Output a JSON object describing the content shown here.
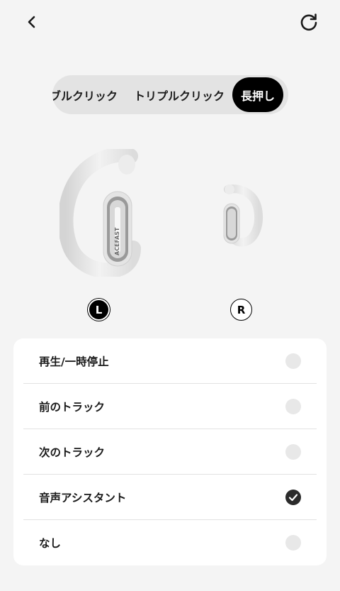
{
  "header": {
    "back_icon": "chevron-left-icon",
    "reset_icon": "refresh-icon"
  },
  "tabs": [
    {
      "label": "ブルクリック",
      "active": false
    },
    {
      "label": "トリプルクリック",
      "active": false
    },
    {
      "label": "長押し",
      "active": true
    }
  ],
  "earbuds": {
    "left_label": "L",
    "right_label": "R",
    "selected": "L",
    "brand_mark": "ACEFAST"
  },
  "options": [
    {
      "label": "再生/一時停止",
      "checked": false
    },
    {
      "label": "前のトラック",
      "checked": false
    },
    {
      "label": "次のトラック",
      "checked": false
    },
    {
      "label": "音声アシスタント",
      "checked": true
    },
    {
      "label": "なし",
      "checked": false
    }
  ],
  "colors": {
    "background": "#f4f4f4",
    "active_tab": "#000000",
    "checked": "#2b2b2b",
    "unchecked": "#e8e8e8"
  }
}
